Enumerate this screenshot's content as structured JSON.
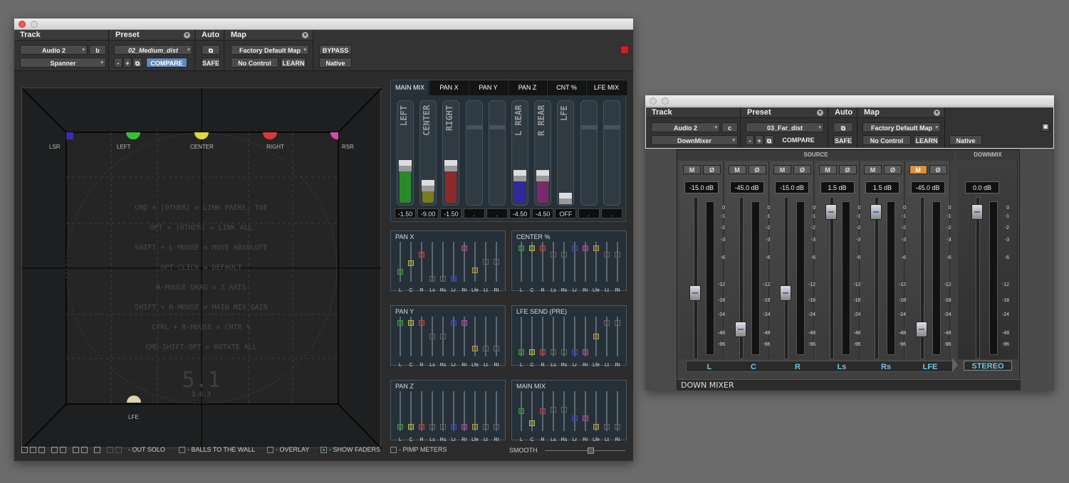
{
  "spanner_window": {
    "track": {
      "title": "Track",
      "name": "Audio 2",
      "suffix": "b",
      "plugin": "Spanner"
    },
    "preset": {
      "title": "Preset",
      "name": "02_Medium_dist",
      "minus": "-",
      "plus": "+",
      "compare": "COMPARE"
    },
    "auto": {
      "title": "Auto",
      "safe": "SAFE"
    },
    "map": {
      "title": "Map",
      "map_name": "Factory Default Map",
      "control": "No Control",
      "learn": "LEARN"
    },
    "bypass": "BYPASS",
    "native": "Native",
    "speakers": [
      "LSR",
      "LEFT",
      "CENTER",
      "RIGHT",
      "RSR",
      "LFE"
    ],
    "commands": [
      "CMD + [OTHER] = LINK PAIRS, TOE",
      "OPT + [OTHER] = LINK ALL",
      "SHIFT + L-MOUSE = MOVE ABSOLUTE",
      "OPT-CLICK = DEFAULT",
      "R-MOUSE DRAG = Z AXIS",
      "SHIFT + R-MOUSE = MAIN MIX GAIN",
      "CTRL + R-MOUSE = CNTR %",
      "CMD-SHIFT-OPT = ROTATE ALL"
    ],
    "format": "5.1",
    "version": "3.0.3",
    "tabs": [
      "MAIN MIX",
      "PAN X",
      "PAN Y",
      "PAN Z",
      "CNT %",
      "LFE MIX"
    ],
    "meters": [
      {
        "label": "LEFT",
        "value": "-1.50",
        "level": 0.37,
        "color": "#2a8a2a"
      },
      {
        "label": "CENTER",
        "value": "-9.00",
        "level": 0.17,
        "color": "#7a7a20"
      },
      {
        "label": "RIGHT",
        "value": "-1.50",
        "level": 0.37,
        "color": "#8a2a2a"
      },
      {
        "label": "",
        "value": ".",
        "level": 0,
        "color": "#000"
      },
      {
        "label": "",
        "value": ".",
        "level": 0,
        "color": "#000"
      },
      {
        "label": "L REAR",
        "value": "-4.50",
        "level": 0.27,
        "color": "#33289a"
      },
      {
        "label": "R REAR",
        "value": "-4.50",
        "level": 0.27,
        "color": "#7a2a6a"
      },
      {
        "label": "LFE",
        "value": "OFF",
        "level": 0.04,
        "color": "#444"
      },
      {
        "label": "",
        "value": ".",
        "level": 0,
        "color": "#000"
      },
      {
        "label": "",
        "value": ".",
        "level": 0,
        "color": "#000"
      }
    ],
    "channels": [
      "L",
      "C",
      "R",
      "Ls",
      "Rs",
      "Lr",
      "Rr",
      "Lfe",
      "Lt",
      "Rt"
    ],
    "minis": [
      "PAN X",
      "CENTER %",
      "PAN Y",
      "LFE SEND (PRE)",
      "PAN Z",
      "MAIN MIX"
    ],
    "options": [
      "- OUT SOLO",
      "- BALLS TO THE WALL",
      "- OVERLAY",
      "- SHOW FADERS",
      "- PIMP METERS",
      "SMOOTH"
    ]
  },
  "downmixer_window": {
    "track": {
      "title": "Track",
      "name": "Audio 2",
      "suffix": "c",
      "plugin": "DownMixer"
    },
    "preset": {
      "title": "Preset",
      "name": "03_Far_dist",
      "minus": "-",
      "plus": "+",
      "compare": "COMPARE"
    },
    "auto": {
      "title": "Auto",
      "safe": "SAFE"
    },
    "map": {
      "title": "Map",
      "map_name": "Factory Default Map",
      "control": "No Control",
      "learn": "LEARN"
    },
    "native": "Native",
    "source_label": "SOURCE",
    "downmix_label": "DOWNMIX",
    "mute": "M",
    "phase": "Ø",
    "strips": [
      {
        "name": "L",
        "db": "-15.0 dB",
        "pos": 0.6
      },
      {
        "name": "C",
        "db": "-45.0 dB",
        "pos": 0.85
      },
      {
        "name": "R",
        "db": "-15.0 dB",
        "pos": 0.6
      },
      {
        "name": "Ls",
        "db": "1.5 dB",
        "pos": 0.05
      },
      {
        "name": "Rs",
        "db": "1.5 dB",
        "pos": 0.05
      },
      {
        "name": "LFE",
        "db": "-45.0 dB",
        "pos": 0.85
      }
    ],
    "stereo": {
      "name": "STEREO",
      "db": "0.0 dB",
      "pos": 0.05
    },
    "scale": [
      "0",
      "-1",
      "-2",
      "-3",
      "-6",
      "-12",
      "-18",
      "-24",
      "-48",
      "-96"
    ],
    "footer": "DOWN MIXER"
  }
}
